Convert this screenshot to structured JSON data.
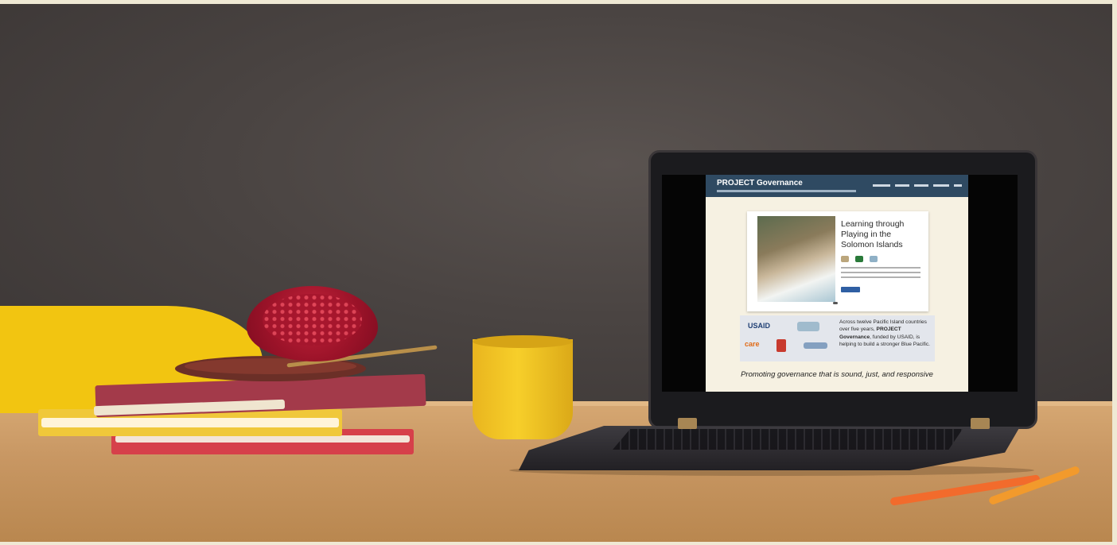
{
  "laptop_screen": {
    "site_title": "PROJECT Governance",
    "slide": {
      "title": "Learning through Playing in the Solomon Islands"
    },
    "partners": {
      "usaid_logo": "USAID",
      "care_logo": "care",
      "intro": "Across twelve Pacific Island countries over five years, ",
      "project_name": "PROJECT Governance",
      "outro": ", funded by USAID, is helping to build a stronger Blue Pacific."
    },
    "promo": "Promoting governance that is sound, just, and responsive"
  },
  "colors": {
    "header": "#2f4a62",
    "button": "#2f5fa3",
    "usaid": "#1f3f74",
    "care": "#e06a16"
  }
}
